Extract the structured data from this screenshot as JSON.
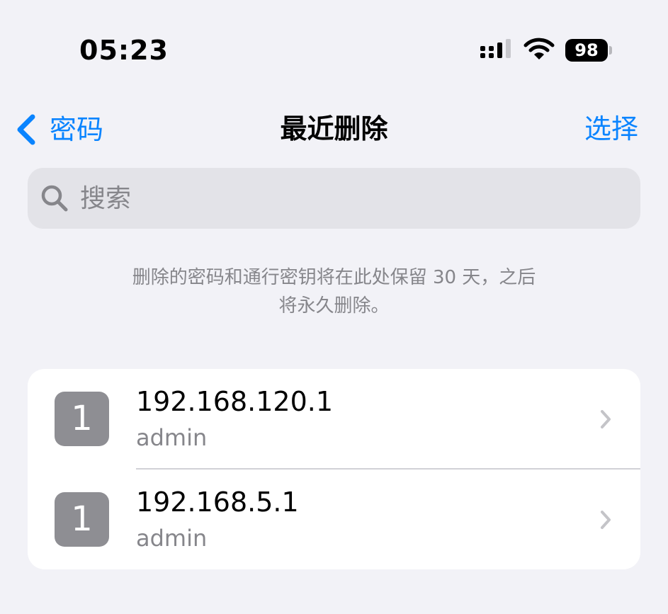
{
  "status_bar": {
    "time": "05:23",
    "battery_level": "98",
    "icons": [
      "cellular-signal-icon",
      "wifi-icon",
      "battery-icon"
    ]
  },
  "nav": {
    "back_label": "密码",
    "title": "最近删除",
    "select_label": "选择"
  },
  "search": {
    "placeholder": "搜索",
    "value": ""
  },
  "info": {
    "line1": "删除的密码和通行密钥将在此处保留 30 天，之后",
    "line2": "将永久删除。"
  },
  "list": {
    "items": [
      {
        "badge": "1",
        "title": "192.168.120.1",
        "subtitle": "admin"
      },
      {
        "badge": "1",
        "title": "192.168.5.1",
        "subtitle": "admin"
      }
    ]
  },
  "colors": {
    "accent": "#0a84ff",
    "background": "#f2f2f7",
    "secondary_text": "#86868b",
    "badge": "#8e8e93"
  }
}
